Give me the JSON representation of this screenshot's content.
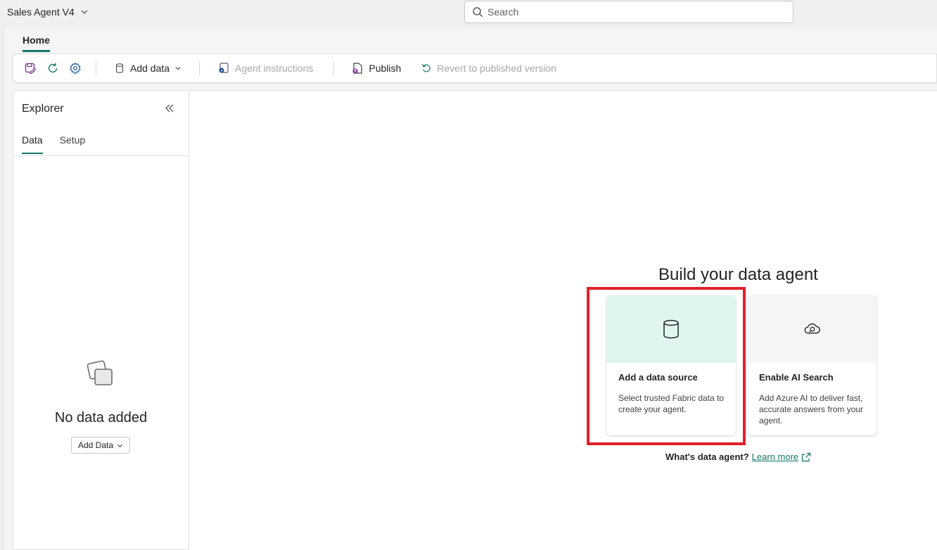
{
  "app": {
    "title": "Sales Agent V4"
  },
  "search": {
    "placeholder": "Search"
  },
  "ribbon": {
    "tab": "Home",
    "add_data": "Add data",
    "agent_instructions": "Agent instructions",
    "publish": "Publish",
    "revert": "Revert to published version",
    "icons": [
      "save-icon",
      "refresh-icon",
      "settings-icon",
      "database-icon",
      "agent-instructions-icon",
      "publish-icon",
      "revert-icon"
    ]
  },
  "explorer": {
    "title": "Explorer",
    "tabs": [
      "Data",
      "Setup"
    ],
    "active_tab": "Data",
    "empty_title": "No data added",
    "add_data_button": "Add Data"
  },
  "main": {
    "title": "Build your data agent",
    "cards": [
      {
        "title": "Add a data source",
        "description": "Select trusted Fabric data to create your agent.",
        "icon": "database-icon",
        "bg": "#e0f5ef"
      },
      {
        "title": "Enable AI Search",
        "description": "Add Azure AI to deliver fast, accurate answers from your agent.",
        "icon": "cloud-search-icon",
        "bg": "#f5f5f5"
      }
    ],
    "footer_question": "What's data agent?",
    "learn_more": "Learn more"
  },
  "colors": {
    "accent": "#117865",
    "highlight": "#e3202a"
  }
}
